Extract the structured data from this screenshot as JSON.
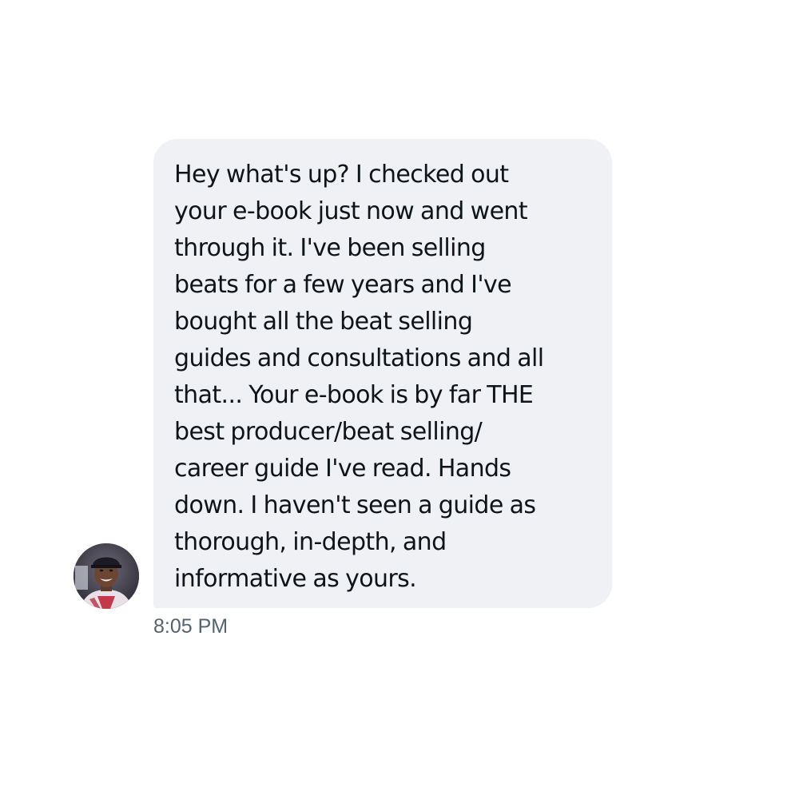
{
  "conversation": {
    "message": {
      "lines": [
        "Hey what's up? I checked out",
        "your e-book just now and went",
        "through it. I've been selling",
        "beats for a few years and I've",
        "bought all the beat selling",
        "guides and consultations and all",
        "that... Your e-book is by far THE",
        "best producer/beat selling/",
        "career guide I've read. Hands",
        "down. I haven't seen a guide as",
        "thorough, in-depth, and",
        "informative as yours."
      ],
      "timestamp": "8:05 PM"
    },
    "sender": {
      "avatar_icon": "user-avatar-photo"
    }
  },
  "colors": {
    "bubble_background": "#eff1f4",
    "message_text": "#0f1419",
    "timestamp_text": "#536471",
    "page_background": "#ffffff"
  }
}
